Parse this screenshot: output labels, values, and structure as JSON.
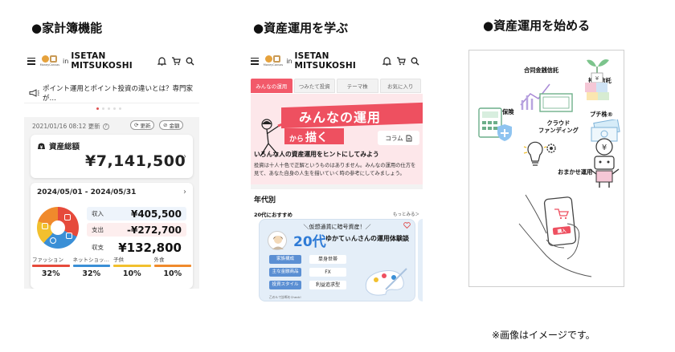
{
  "headings": {
    "col1": "●家計簿機能",
    "col2": "●資産運用を学ぶ",
    "col3": "●資産運用を始める"
  },
  "appbar": {
    "logo_small": "MoneyCanvas",
    "brand_in": "in",
    "brand_name": "ISETAN MITSUKOSHI"
  },
  "household": {
    "notice": "ポイント運用とポイント投資の違いとは？専門家が…",
    "updated": "2021/01/16 08:12 更新",
    "refresh_label": "更新",
    "amount_label": "金額",
    "total_assets_label": "資産総額",
    "total_assets": "¥7,141,500",
    "period": "2024/05/01 - 2024/05/31",
    "rows": [
      {
        "label": "収入",
        "value": "¥405,500"
      },
      {
        "label": "支出",
        "value": "-¥272,700"
      },
      {
        "label": "収支",
        "value": "¥132,800"
      }
    ],
    "categories": [
      {
        "name": "ファッション",
        "percent": "32%",
        "color": "#e64a3b"
      },
      {
        "name": "ネットショッ…",
        "percent": "32%",
        "color": "#3a8fd6"
      },
      {
        "name": "子供",
        "percent": "10%",
        "color": "#f2c02e"
      },
      {
        "name": "外食",
        "percent": "10%",
        "color": "#f08a2c"
      }
    ]
  },
  "learn": {
    "tabs": [
      "みんなの運用",
      "つみたて投資",
      "テーマ株",
      "お気に入り"
    ],
    "hero_title": "みんなの運用",
    "hero_sub1": "から",
    "hero_sub2": "描く",
    "column_tag": "コラム",
    "headline": "いろんな人の資産運用をヒントにしてみよう",
    "description": "投資は十人十色で正解というものはありません。みんなの運用の仕方を見て、あなた自身の人生を描いていく時の参考にしてみましょう。",
    "section_title": "年代別",
    "subsection": "20代におすすめ",
    "more_link": "もっとみる＞",
    "card": {
      "tagline": "＼仮想通貨に暗号資産！／",
      "age": "20代",
      "title": "ゆかてぃんさんの運用体験談",
      "rows": [
        {
          "key": "家族構成",
          "value": "単身世帯"
        },
        {
          "key": "主な金融商品",
          "value": "FX"
        },
        {
          "key": "投資スタイル",
          "value": "利益追求型"
        }
      ],
      "note": "乙のルで診断をCheck!"
    }
  },
  "start": {
    "labels": {
      "trust": "合同金銭信託",
      "fund": "投資信託",
      "insurance": "保険",
      "puchi": "プチ株®",
      "crowd": "クラウド\nファンディング",
      "robo": "おまかせ運用",
      "buy": "購入"
    }
  },
  "footnote": "※画像はイメージです。",
  "colors": {
    "accent_red": "#ee5060",
    "pie_red": "#e64a3b",
    "pie_blue": "#3a8fd6",
    "pie_yellow": "#f2c02e",
    "pie_orange": "#f08a2c",
    "card_blue": "#5b8fd3"
  },
  "icons": [
    "menu-icon",
    "bell-icon",
    "cart-icon",
    "search-icon",
    "megaphone-icon",
    "wallet-icon",
    "info-icon",
    "column-icon",
    "heart-icon"
  ]
}
